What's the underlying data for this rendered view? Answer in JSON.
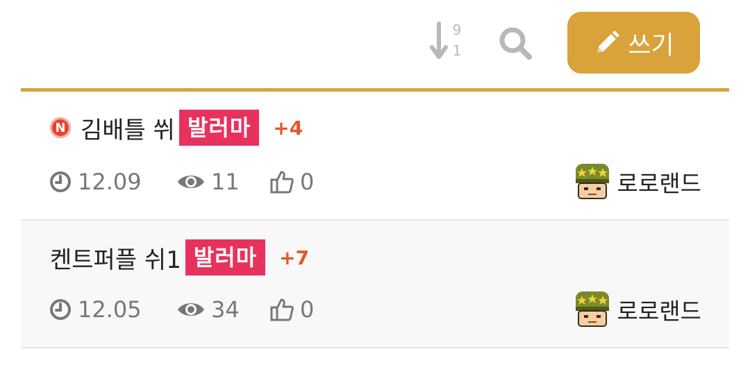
{
  "toolbar": {
    "sort_icon": "sort-numeric-desc-icon",
    "search_icon": "search-icon",
    "write_label": "쓰기",
    "write_icon": "pencil-icon",
    "accent_color": "#d9a23a"
  },
  "posts": [
    {
      "new_badge": "N",
      "title": "김배틀 쒸",
      "tag": "발러마",
      "comments": "+4",
      "date": "12.09",
      "views": "11",
      "likes": "0",
      "author": "로로랜드"
    },
    {
      "title": "켄트퍼플 쉬1",
      "tag": "발러마",
      "comments": "+7",
      "date": "12.05",
      "views": "34",
      "likes": "0",
      "author": "로로랜드"
    }
  ],
  "colors": {
    "tag_bg": "#e8325e",
    "comment_count": "#e05a2a",
    "new_badge": "#e8432f"
  }
}
